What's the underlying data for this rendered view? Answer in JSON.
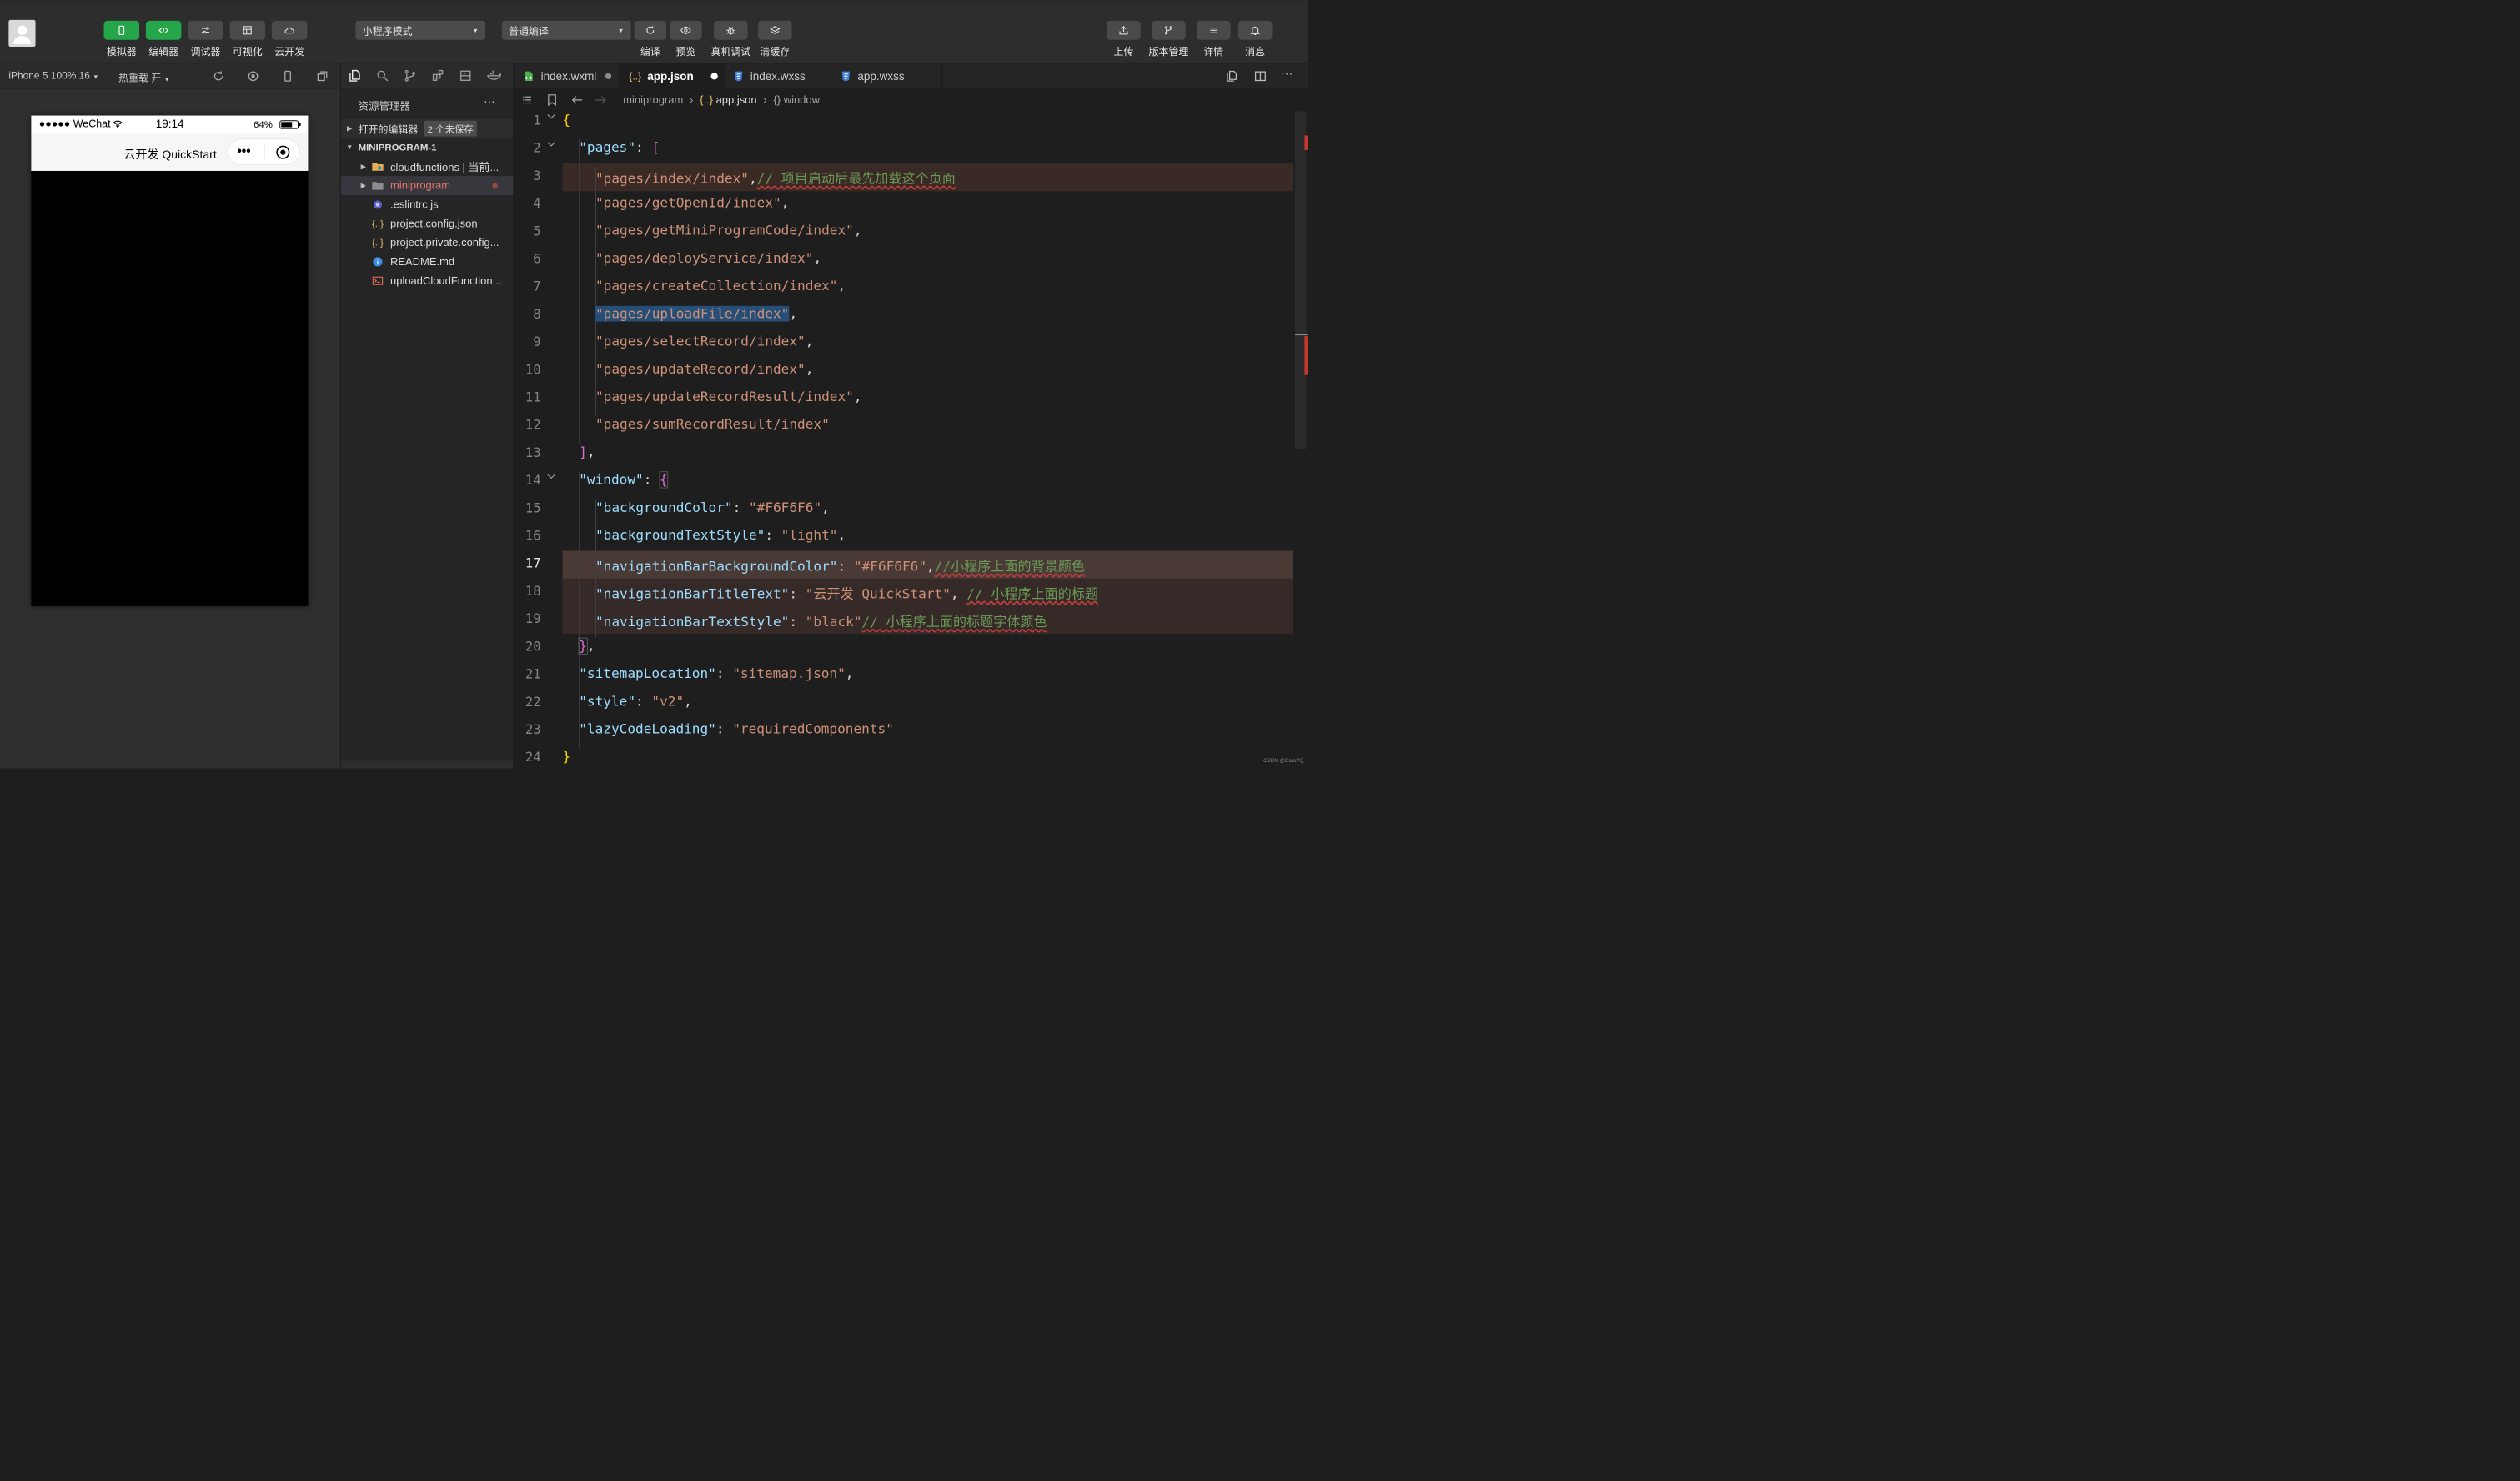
{
  "toolbar": {
    "left_buttons": [
      {
        "label": "模拟器",
        "icon": "phone-icon"
      },
      {
        "label": "编辑器",
        "icon": "code-icon"
      },
      {
        "label": "调试器",
        "icon": "sliders-icon"
      },
      {
        "label": "可视化",
        "icon": "layout-icon"
      },
      {
        "label": "云开发",
        "icon": "cloud-icon"
      }
    ],
    "mode_select": "小程序模式",
    "compile_select": "普通编译",
    "mid_buttons": [
      {
        "label": "编译",
        "icon": "refresh-icon"
      },
      {
        "label": "预览",
        "icon": "eye-icon"
      },
      {
        "label": "真机调试",
        "icon": "bug-icon"
      },
      {
        "label": "清缓存",
        "icon": "layers-icon"
      }
    ],
    "right_buttons": [
      {
        "label": "上传",
        "icon": "upload-icon"
      },
      {
        "label": "版本管理",
        "icon": "branch-icon"
      },
      {
        "label": "详情",
        "icon": "menu-icon"
      },
      {
        "label": "消息",
        "icon": "bell-icon"
      }
    ]
  },
  "simulator": {
    "device": "iPhone 5 100% 16",
    "hot_reload": "热重载 开",
    "status_left": "●●●●● WeChat",
    "time": "19:14",
    "battery": "64%",
    "nav_title": "云开发 QuickStart",
    "capsule_more": "•••"
  },
  "explorer": {
    "title": "资源管理器",
    "more": "···",
    "open_editors": "打开的编辑器",
    "unsaved_badge": "2 个未保存",
    "project": "MINIPROGRAM-1",
    "items": [
      {
        "name": "cloudfunctions | 当前...",
        "icon": "folder-icon"
      },
      {
        "name": "miniprogram",
        "icon": "folder-icon"
      },
      {
        "name": ".eslintrc.js",
        "icon": "eslint-icon"
      },
      {
        "name": "project.config.json",
        "icon": "json-icon"
      },
      {
        "name": "project.private.config...",
        "icon": "json-icon"
      },
      {
        "name": "README.md",
        "icon": "info-icon"
      },
      {
        "name": "uploadCloudFunction...",
        "icon": "terminal-icon"
      }
    ]
  },
  "tabs": [
    {
      "name": "index.wxml",
      "icon": "wxml-icon"
    },
    {
      "name": "app.json",
      "icon": "json-icon"
    },
    {
      "name": "index.wxss",
      "icon": "css-icon"
    },
    {
      "name": "app.wxss",
      "icon": "css-icon"
    }
  ],
  "breadcrumb": {
    "folder": "miniprogram",
    "file": "app.json",
    "node": "window"
  },
  "code": {
    "line_numbers": [
      "1",
      "2",
      "3",
      "4",
      "5",
      "6",
      "7",
      "8",
      "9",
      "10",
      "11",
      "12",
      "13",
      "14",
      "15",
      "16",
      "17",
      "18",
      "19",
      "20",
      "21",
      "22",
      "23",
      "24"
    ],
    "pages": [
      "\"pages/index/index\"",
      "\"pages/getOpenId/index\"",
      "\"pages/getMiniProgramCode/index\"",
      "\"pages/deployService/index\"",
      "\"pages/createCollection/index\"",
      "\"pages/uploadFile/index\"",
      "\"pages/selectRecord/index\"",
      "\"pages/updateRecord/index\"",
      "\"pages/updateRecordResult/index\"",
      "\"pages/sumRecordResult/index\""
    ],
    "comment_index": "// 项目启动后最先加载这个页面",
    "k_pages": "\"pages\"",
    "k_window": "\"window\"",
    "k_bg": "\"backgroundColor\"",
    "v_bg": "\"#F6F6F6\"",
    "k_bgts": "\"backgroundTextStyle\"",
    "v_bgts": "\"light\"",
    "k_navbg": "\"navigationBarBackgroundColor\"",
    "v_navbg": "\"#F6F6F6\"",
    "c_navbg": "//小程序上面的背景颜色",
    "k_navtitle": "\"navigationBarTitleText\"",
    "v_navtitle": "\"云开发 QuickStart\"",
    "c_navtitle": "// 小程序上面的标题",
    "k_navts": "\"navigationBarTextStyle\"",
    "v_navts": "\"black\"",
    "c_navts": "// 小程序上面的标题字体颜色",
    "k_sitemap": "\"sitemapLocation\"",
    "v_sitemap": "\"sitemap.json\"",
    "k_style": "\"style\"",
    "v_style": "\"v2\"",
    "k_lazy": "\"lazyCodeLoading\"",
    "v_lazy": "\"requiredComponents\""
  },
  "credit": "CSDN @CaraYQ",
  "colors": {
    "accent_green": "#26a64a",
    "folder_open": "#e8ab53",
    "modified": "#e2786d"
  }
}
